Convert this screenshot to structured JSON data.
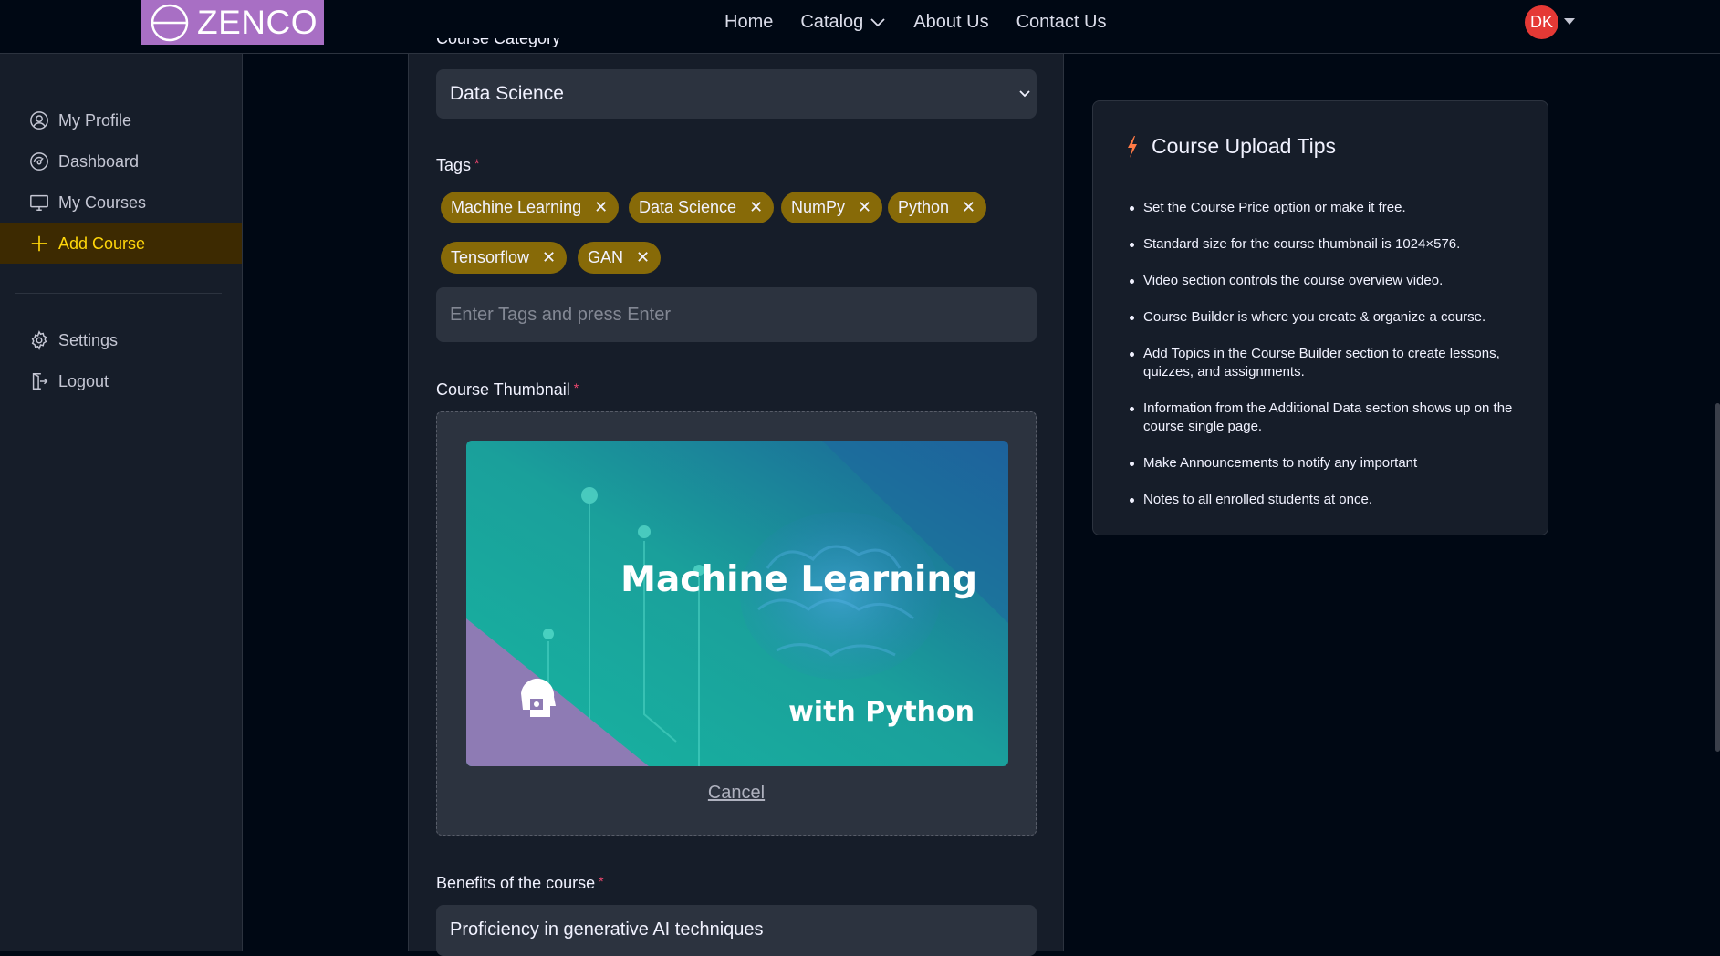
{
  "navbar": {
    "logo_text": "ZENCO",
    "links": [
      "Home",
      "Catalog",
      "About Us",
      "Contact Us"
    ],
    "avatar_initials": "DK"
  },
  "sidebar": {
    "items": [
      "My Profile",
      "Dashboard",
      "My Courses",
      "Add Course"
    ],
    "bottom_items": [
      "Settings",
      "Logout"
    ],
    "active_item": "Add Course"
  },
  "form": {
    "category_label_partial": "Course Category",
    "category_value": "Data Science",
    "tags_label": "Tags",
    "required_mark": "*",
    "tags": [
      "Machine Learning",
      "Data Science",
      "NumPy",
      "Python",
      "Tensorflow",
      "GAN"
    ],
    "tag_remove_symbol": "✕",
    "tags_input_placeholder": "Enter Tags and press Enter",
    "thumbnail_label": "Course Thumbnail",
    "thumbnail_title_line1": "Machine Learning",
    "thumbnail_title_line2": "with Python",
    "cancel_label": "Cancel",
    "benefits_label": "Benefits of the course",
    "benefits_value": "Proficiency in generative AI techniques"
  },
  "tips": {
    "title": "Course Upload Tips",
    "items": [
      "Set the Course Price option or make it free.",
      "Standard size for the course thumbnail is 1024×576.",
      "Video section controls the course overview video.",
      "Course Builder is where you create & organize a course.",
      "Add Topics in the Course Builder section to create lessons, quizzes, and assignments.",
      "Information from the Additional Data section shows up on the course single page.",
      "Make Announcements to notify any important",
      "Notes to all enrolled students at once."
    ]
  },
  "colors": {
    "background": "#000814",
    "panel": "#161D29",
    "input": "#2C333F",
    "accent_yellow": "#FFD60A",
    "tag": "#876A08",
    "required": "#EF476F",
    "logo_bg": "#A86FC4",
    "avatar_bg": "#E53935",
    "tip_icon": "#FF7A45"
  }
}
